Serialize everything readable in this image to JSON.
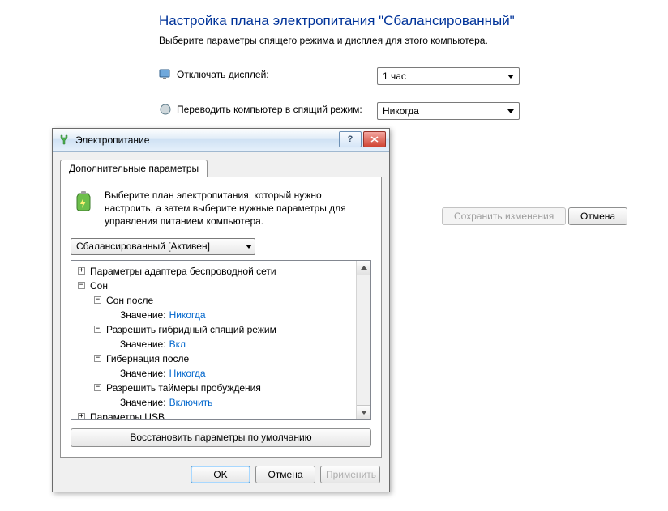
{
  "bg": {
    "title": "Настройка плана электропитания \"Сбалансированный\"",
    "subtitle": "Выберите параметры спящего режима и дисплея для этого компьютера.",
    "rows": {
      "display_off": {
        "label": "Отключать дисплей:",
        "value": "1 час"
      },
      "sleep": {
        "label": "Переводить компьютер в спящий режим:",
        "value": "Никогда"
      }
    },
    "buttons": {
      "save": "Сохранить изменения",
      "cancel": "Отмена"
    }
  },
  "dlg": {
    "title": "Электропитание",
    "help": "?",
    "close": "×",
    "tab": "Дополнительные параметры",
    "intro": "Выберите план электропитания, который нужно настроить, а затем выберите нужные параметры для управления питанием компьютера.",
    "plan_selected": "Сбалансированный [Активен]",
    "restore": "Восстановить параметры по умолчанию",
    "buttons": {
      "ok": "OK",
      "cancel": "Отмена",
      "apply": "Применить"
    },
    "tree": {
      "wireless": "Параметры адаптера беспроводной сети",
      "sleep": "Сон",
      "sleep_after": "Сон после",
      "value_label": "Значение:",
      "sleep_after_val": "Никогда",
      "hybrid": "Разрешить гибридный спящий режим",
      "hybrid_val": "Вкл",
      "hibernate": "Гибернация после",
      "hibernate_val": "Никогда",
      "wake_timers": "Разрешить таймеры пробуждения",
      "wake_timers_val": "Включить",
      "usb": "Параметры USB"
    }
  }
}
